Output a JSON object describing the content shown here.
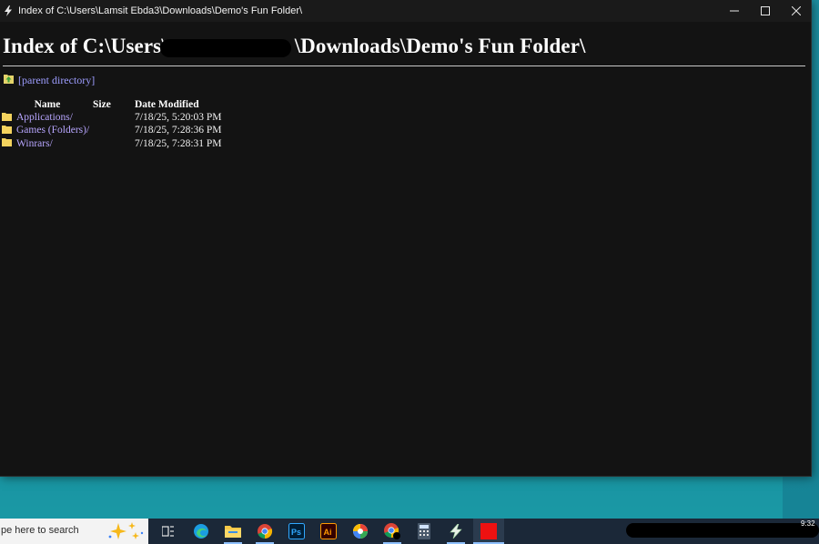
{
  "window": {
    "title": "Index of C:\\Users\\Lamsit Ebda3\\Downloads\\Demo's Fun Folder\\"
  },
  "page": {
    "heading_start": "Index of C:\\Users\\",
    "heading_end": "\\Downloads\\Demo's Fun Folder\\",
    "parent_link": "[parent directory]",
    "columns": {
      "name": "Name",
      "size": "Size",
      "date": "Date Modified"
    },
    "entries": [
      {
        "name": "Applications/",
        "size": "",
        "date": "7/18/25, 5:20:03 PM"
      },
      {
        "name": "Games (Folders)/",
        "size": "",
        "date": "7/18/25, 7:28:36 PM"
      },
      {
        "name": "Winrars/",
        "size": "",
        "date": "7/18/25, 7:28:31 PM"
      }
    ]
  },
  "taskbar": {
    "search_placeholder": "pe here to search",
    "clock_time": "9:32"
  },
  "colors": {
    "window_bg": "#131313",
    "link": "#9d9dff",
    "visited_link": "#b8a6ff",
    "folder_icon": "#f4d35e",
    "taskbar_bg": "#1b2838",
    "desktop": "#14899a"
  },
  "icons": {
    "app": "lightning-icon",
    "parent": "parent-directory-icon",
    "folder": "folder-icon"
  }
}
